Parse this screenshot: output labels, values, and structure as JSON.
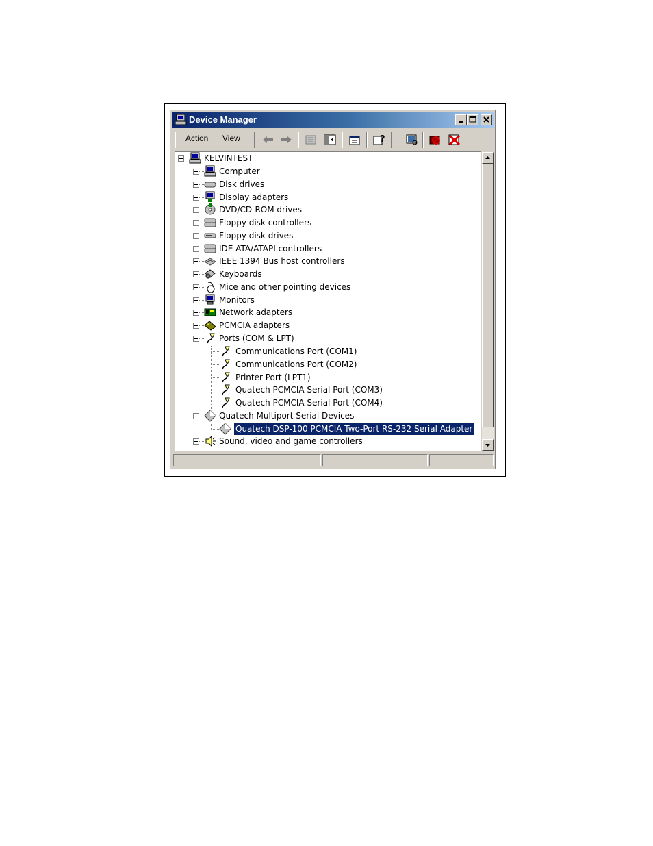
{
  "window": {
    "title": "Device Manager"
  },
  "menu": {
    "action": "Action",
    "view": "View"
  },
  "tree": {
    "root": "KELVINTEST",
    "categories": [
      "Computer",
      "Disk drives",
      "Display adapters",
      "DVD/CD-ROM drives",
      "Floppy disk controllers",
      "Floppy disk drives",
      "IDE ATA/ATAPI controllers",
      "IEEE 1394 Bus host controllers",
      "Keyboards",
      "Mice and other pointing devices",
      "Monitors",
      "Network adapters",
      "PCMCIA adapters"
    ],
    "ports": {
      "label": "Ports (COM & LPT)",
      "children": [
        "Communications Port (COM1)",
        "Communications Port (COM2)",
        "Printer Port (LPT1)",
        "Quatech PCMCIA Serial Port (COM3)",
        "Quatech PCMCIA Serial Port (COM4)"
      ]
    },
    "multiport": {
      "label": "Quatech Multiport Serial Devices",
      "children": [
        "Quatech DSP-100 PCMCIA Two-Port RS-232 Serial Adapter"
      ]
    },
    "sound": "Sound, video and game controllers"
  },
  "colors": {
    "selection": "#0a246a",
    "titlebar": "#0a246a",
    "face": "#d4d0c8"
  }
}
